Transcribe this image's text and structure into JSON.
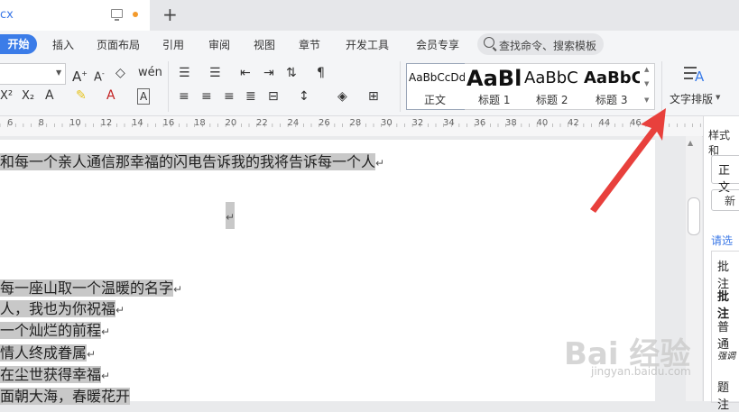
{
  "title_bar": {
    "tab_name": "cx",
    "new_tab": "+"
  },
  "menu": [
    "开始",
    "插入",
    "页面布局",
    "引用",
    "审阅",
    "视图",
    "章节",
    "开发工具",
    "会员专享"
  ],
  "search": {
    "placeholder": "查找命令、搜索模板"
  },
  "styles": [
    {
      "preview": "AaBbCcDd",
      "label": "正文"
    },
    {
      "preview": "AaBl",
      "label": "标题 1"
    },
    {
      "preview": "AaBbC",
      "label": "标题 2"
    },
    {
      "preview": "AaBbC",
      "label": "标题 3"
    }
  ],
  "text_layout": {
    "label": "文字排版"
  },
  "ruler_numbers": [
    "6",
    "8",
    "10",
    "12",
    "14",
    "16",
    "18",
    "20",
    "22",
    "24",
    "26",
    "28",
    "30",
    "32",
    "34",
    "36",
    "38",
    "40",
    "42",
    "44",
    "46"
  ],
  "document": {
    "lines": [
      "和每一个亲人通信那幸福的闪电告诉我的我将告诉每一个人",
      "",
      "",
      "每一座山取一个温暖的名字",
      "人，我也为你祝福",
      "一个灿烂的前程",
      "情人终成眷属",
      "在尘世获得幸福",
      "面朝大海，春暖花开"
    ]
  },
  "panel": {
    "title": "样式和",
    "current_style": "正文",
    "new_button": "新",
    "choose_label": "请选",
    "list": [
      "批注",
      "批注",
      "普通",
      "题注"
    ]
  },
  "watermark": {
    "text": "Bai 经验",
    "sub": "jingyan.baidu.com"
  },
  "colors": {
    "accent": "#3b7ce8",
    "highlight": "#c8c8c8",
    "arrow": "#e8403c"
  }
}
